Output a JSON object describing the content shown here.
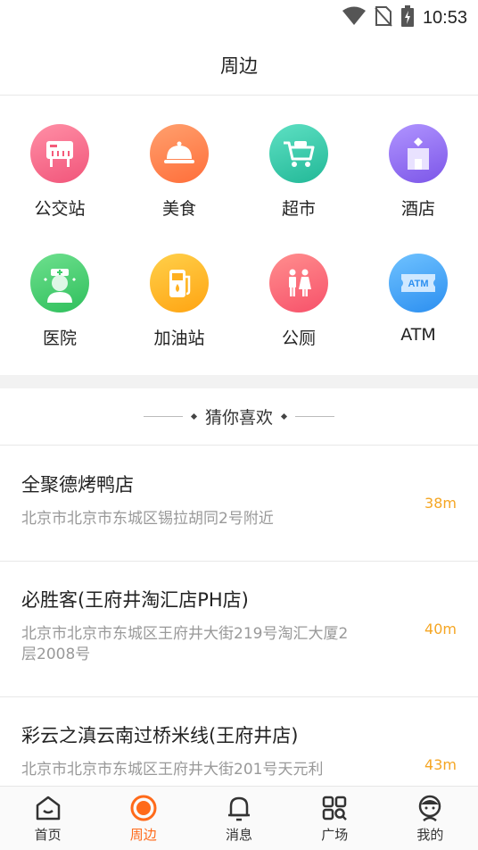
{
  "status_bar": {
    "time": "10:53"
  },
  "header": {
    "title": "周边"
  },
  "categories": [
    {
      "label": "公交站",
      "icon": "bus-stop-icon",
      "color": "#f45b7a"
    },
    {
      "label": "美食",
      "icon": "food-cloche-icon",
      "color": "#ff7b4a"
    },
    {
      "label": "超市",
      "icon": "shopping-cart-icon",
      "color": "#2dc5a6"
    },
    {
      "label": "酒店",
      "icon": "hotel-building-icon",
      "color": "#8f6cf0"
    },
    {
      "label": "医院",
      "icon": "doctor-icon",
      "color": "#3ecf6a"
    },
    {
      "label": "加油站",
      "icon": "gas-pump-icon",
      "color": "#ffb020"
    },
    {
      "label": "公厕",
      "icon": "restroom-icon",
      "color": "#ff6a6a"
    },
    {
      "label": "ATM",
      "icon": "atm-icon",
      "color": "#3ea2f5"
    }
  ],
  "guess_section": {
    "title": "猜你喜欢"
  },
  "places": [
    {
      "name": "全聚德烤鸭店",
      "address": "北京市北京市东城区锡拉胡同2号附近",
      "distance": "38m"
    },
    {
      "name": "必胜客(王府井淘汇店PH店)",
      "address": "北京市北京市东城区王府井大街219号淘汇大厦2层2008号",
      "distance": "40m"
    },
    {
      "name": "彩云之滇云南过桥米线(王府井店)",
      "address": "北京市北京市东城区王府井大街201号天元利",
      "distance": "43m"
    }
  ],
  "tabbar": {
    "active_color": "#ff6a1a",
    "tabs": [
      {
        "label": "首页",
        "icon": "home-icon"
      },
      {
        "label": "周边",
        "icon": "nearby-target-icon"
      },
      {
        "label": "消息",
        "icon": "bell-icon"
      },
      {
        "label": "广场",
        "icon": "grid-search-icon"
      },
      {
        "label": "我的",
        "icon": "profile-icon"
      }
    ]
  }
}
